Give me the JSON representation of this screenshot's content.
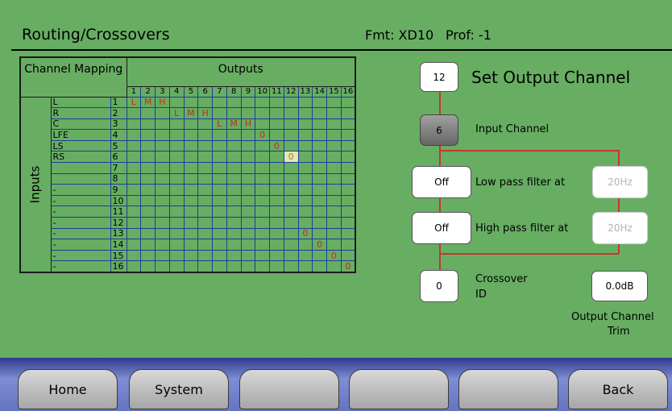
{
  "header": {
    "title": "Routing/Crossovers",
    "fmt": "Fmt: XD10",
    "prof": "Prof: -1"
  },
  "matrix": {
    "mapping_header": "Channel Mapping",
    "outputs_header": "Outputs",
    "inputs_label": "Inputs",
    "output_numbers": [
      "1",
      "2",
      "3",
      "4",
      "5",
      "6",
      "7",
      "8",
      "9",
      "10",
      "11",
      "12",
      "13",
      "14",
      "15",
      "16"
    ],
    "rows": [
      {
        "name": "L",
        "num": "1",
        "cells": [
          [
            "1",
            "L"
          ],
          [
            "2",
            "M"
          ],
          [
            "3",
            "H"
          ]
        ]
      },
      {
        "name": "R",
        "num": "2",
        "cells": [
          [
            "4",
            "L"
          ],
          [
            "5",
            "M"
          ],
          [
            "6",
            "H"
          ]
        ]
      },
      {
        "name": "C",
        "num": "3",
        "cells": [
          [
            "7",
            "L"
          ],
          [
            "8",
            "M"
          ],
          [
            "9",
            "H"
          ]
        ]
      },
      {
        "name": "LFE",
        "num": "4",
        "cells": [
          [
            "10",
            "0"
          ]
        ]
      },
      {
        "name": "LS",
        "num": "5",
        "cells": [
          [
            "11",
            "0"
          ]
        ]
      },
      {
        "name": "RS",
        "num": "6",
        "cells": [
          [
            "12",
            "0"
          ]
        ]
      },
      {
        "name": "",
        "num": "7",
        "cells": []
      },
      {
        "name": "",
        "num": "8",
        "cells": []
      },
      {
        "name": "-",
        "num": "9",
        "cells": []
      },
      {
        "name": "-",
        "num": "10",
        "cells": []
      },
      {
        "name": "-",
        "num": "11",
        "cells": []
      },
      {
        "name": "-",
        "num": "12",
        "cells": []
      },
      {
        "name": "-",
        "num": "13",
        "cells": [
          [
            "13",
            "0"
          ]
        ]
      },
      {
        "name": "-",
        "num": "14",
        "cells": [
          [
            "14",
            "0"
          ]
        ]
      },
      {
        "name": "-",
        "num": "15",
        "cells": [
          [
            "15",
            "0"
          ]
        ]
      },
      {
        "name": "-",
        "num": "16",
        "cells": [
          [
            "16",
            "0"
          ]
        ]
      }
    ],
    "selected_cell": {
      "row": "6",
      "col": "12"
    }
  },
  "panel": {
    "output_channel_value": "12",
    "output_channel_label": "Set Output Channel",
    "input_channel_value": "6",
    "input_channel_label": "Input Channel",
    "lowpass_value": "Off",
    "lowpass_label": "Low pass filter at",
    "lowpass_freq": "20Hz",
    "highpass_value": "Off",
    "highpass_label": "High pass filter at",
    "highpass_freq": "20Hz",
    "crossover_value": "0",
    "crossover_label_1": "Crossover",
    "crossover_label_2": "ID",
    "trim_value": "0.0dB",
    "trim_label_1": "Output Channel",
    "trim_label_2": "Trim"
  },
  "nav": {
    "home": "Home",
    "system": "System",
    "blank1": "",
    "blank2": "",
    "blank3": "",
    "back": "Back"
  },
  "colors": {
    "background": "#67ae63",
    "grid_lines": "#1d3e92",
    "assignment_text": "#cc2a12",
    "connector_lines": "#c8362a",
    "nav_bar": "#6474c0"
  }
}
